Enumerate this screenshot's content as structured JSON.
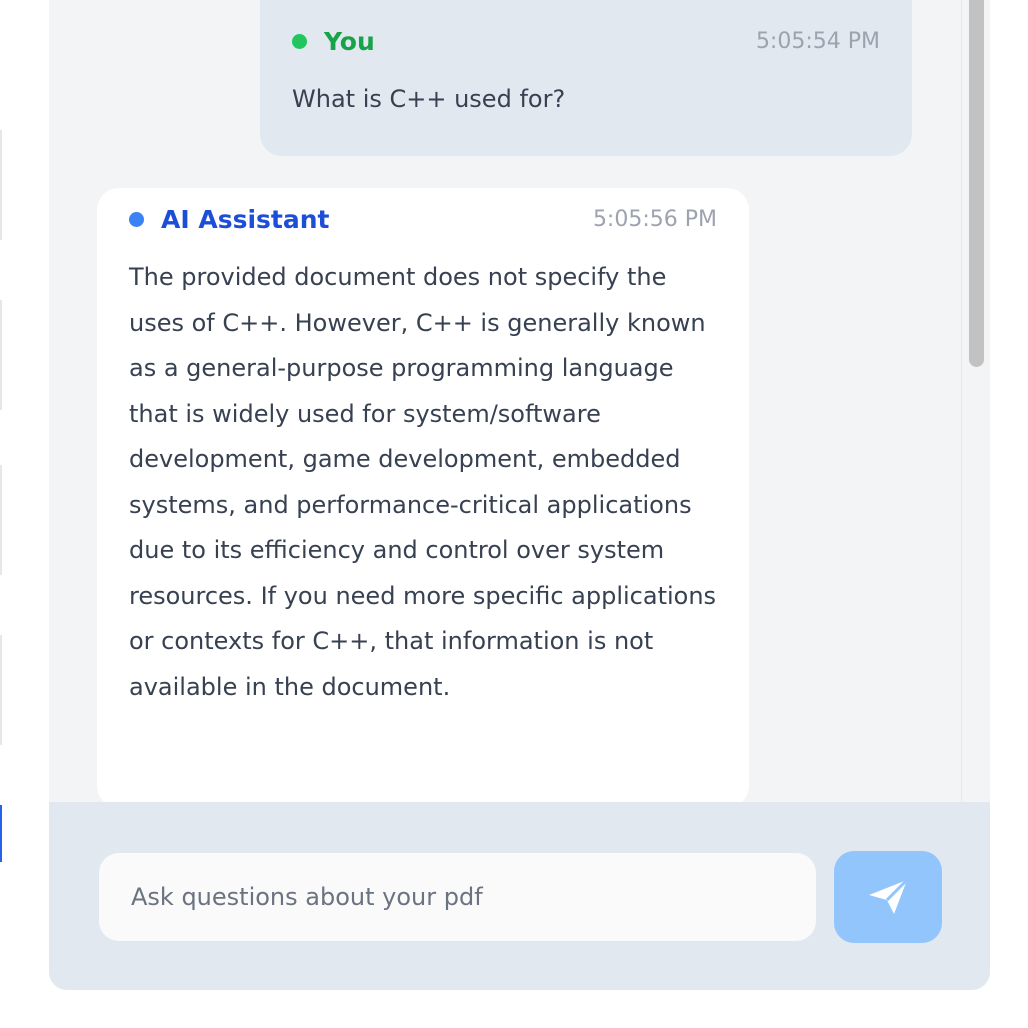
{
  "colors": {
    "user_accent": "#16a34a",
    "user_dot": "#22c55e",
    "ai_accent": "#1d4ed8",
    "ai_dot": "#3b82f6",
    "send_button": "#93c5fd"
  },
  "messages": [
    {
      "role": "user",
      "sender": "You",
      "time": "5:05:54 PM",
      "text": "What is C++ used for?"
    },
    {
      "role": "assistant",
      "sender": "AI Assistant",
      "time": "5:05:56 PM",
      "text": "The provided document does not specify the uses of C++. However, C++ is generally known as a general-purpose programming language that is widely used for system/software development, game development, embedded systems, and performance-critical applications due to its efficiency and control over system resources. If you need more specific applications or contexts for C++, that information is not available in the document."
    }
  ],
  "composer": {
    "placeholder": "Ask questions about your pdf",
    "value": "",
    "send_icon": "send-icon"
  }
}
